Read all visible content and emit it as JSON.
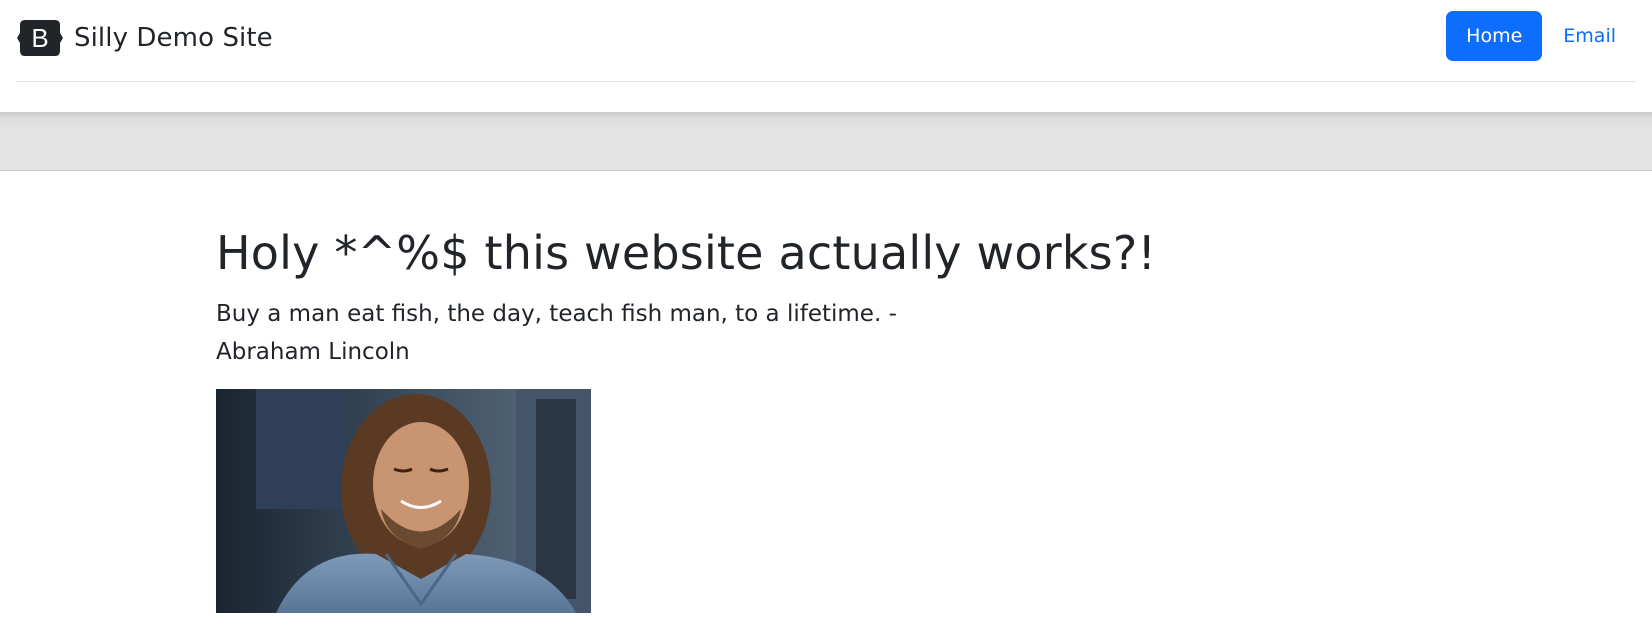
{
  "header": {
    "brand_letter": "B",
    "brand_title": "Silly Demo Site",
    "nav": [
      {
        "label": "Home",
        "active": true
      },
      {
        "label": "Email",
        "active": false
      }
    ]
  },
  "main": {
    "headline": "Holy *^%$ this website actually works?!",
    "quote": "Buy a man eat fish, the day, teach fish man, to a lifetime. -Abraham Lincoln",
    "image_description": "smiling long-haired man in denim shirt"
  },
  "colors": {
    "primary": "#0d6efd",
    "text": "#212529",
    "band": "#e4e4e4"
  }
}
